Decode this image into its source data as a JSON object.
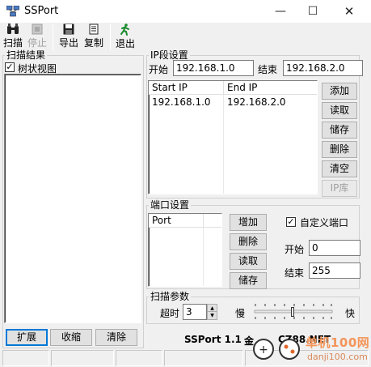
{
  "window": {
    "title": "SSPort",
    "minimize": "—",
    "maximize": "☐",
    "close": "✕"
  },
  "toolbar": {
    "scan": "扫描",
    "stop": "停止",
    "export": "导出",
    "copy": "复制",
    "exit": "退出"
  },
  "scan_results": {
    "group_title": "扫描结果",
    "tree_view_label": "树状视图",
    "tree_view_checked": true,
    "expand": "扩展",
    "collapse": "收缩",
    "clear": "清除"
  },
  "ip_settings": {
    "group_title": "IP段设置",
    "start_label": "开始",
    "start_value": "192.168.1.0",
    "end_label": "结束",
    "end_value": "192.168.2.0",
    "columns": [
      "Start IP",
      "End IP"
    ],
    "rows": [
      {
        "start": "192.168.1.0",
        "end": "192.168.2.0"
      }
    ],
    "buttons": {
      "add": "添加",
      "read": "读取",
      "save": "储存",
      "delete": "删除",
      "clear": "清空",
      "ip_lib": "IP库"
    }
  },
  "port_settings": {
    "group_title": "端口设置",
    "column": "Port",
    "buttons": {
      "add": "增加",
      "delete": "删除",
      "read": "读取",
      "save": "储存"
    },
    "custom_label": "自定义端口",
    "custom_checked": true,
    "start_label": "开始",
    "start_value": "0",
    "end_label": "结束",
    "end_value": "255"
  },
  "scan_params": {
    "group_title": "扫描参数",
    "timeout_label": "超时",
    "timeout_value": "3",
    "slow_label": "慢",
    "fast_label": "快",
    "speed_level": 0.5
  },
  "footer": {
    "brand": "SSPort 1.1",
    "author": "金",
    "site": "CZ88.NET"
  },
  "watermark": {
    "text": "单机100网",
    "url": "danji100.com"
  }
}
